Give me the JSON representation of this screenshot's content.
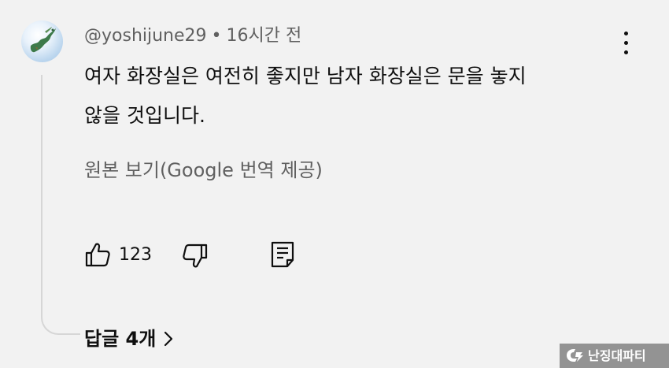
{
  "comment": {
    "handle": "@yoshijune29",
    "separator": "•",
    "time": "16시간 전",
    "text_line1": "여자 화장실은 여전히 좋지만 남자 화장실은 문을 놓지",
    "text_line2": "않을 것입니다.",
    "translate_link": "원본 보기(Google 번역 제공)",
    "like_count": "123",
    "replies_label": "답글 4개"
  },
  "icons": {
    "avatar": "avatar-globe-image",
    "menu": "more-vert-icon",
    "like": "thumbs-up-icon",
    "dislike": "thumbs-down-icon",
    "reply": "reply-comment-icon",
    "chevron": "chevron-right-icon"
  },
  "watermark": {
    "text": "난징대파티"
  },
  "colors": {
    "background": "#f2f2f2",
    "text_primary": "#0f0f0f",
    "text_secondary": "#606060"
  }
}
